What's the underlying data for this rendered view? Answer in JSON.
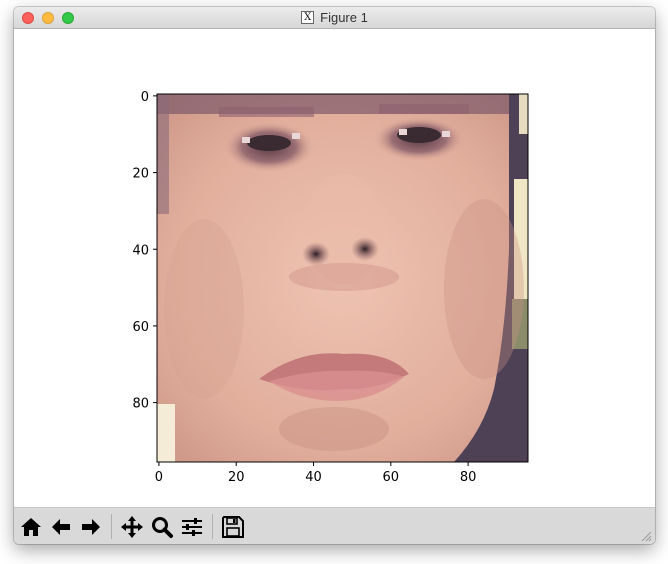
{
  "window": {
    "title": "Figure 1",
    "app_icon": "x11-icon"
  },
  "figure": {
    "image_description_icon": "face-photo",
    "x_ticks": [
      "0",
      "20",
      "40",
      "60",
      "80"
    ],
    "y_ticks": [
      "0",
      "20",
      "40",
      "60",
      "80"
    ],
    "x_range": [
      -0.5,
      95.5
    ],
    "y_range": [
      -0.5,
      95.5
    ]
  },
  "toolbar": {
    "buttons": [
      {
        "name": "home",
        "icon": "home-icon"
      },
      {
        "name": "back",
        "icon": "arrow-left-icon"
      },
      {
        "name": "forward",
        "icon": "arrow-right-icon"
      },
      {
        "name": "pan",
        "icon": "move-icon"
      },
      {
        "name": "zoom",
        "icon": "magnifier-icon"
      },
      {
        "name": "configure-subplots",
        "icon": "sliders-icon"
      },
      {
        "name": "save",
        "icon": "floppy-disk-icon"
      }
    ]
  },
  "colors": {
    "skin": "#e8b8a6",
    "titlebar": "#e3e3e3",
    "toolbar": "#d9d9d9"
  }
}
